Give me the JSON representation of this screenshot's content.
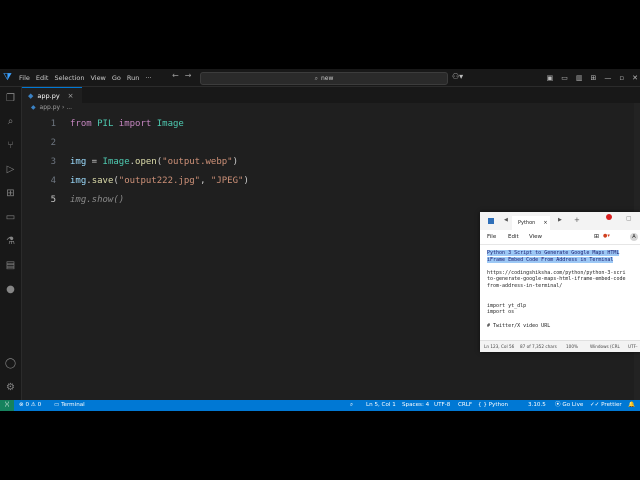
{
  "menu": [
    "File",
    "Edit",
    "Selection",
    "View",
    "Go",
    "Run"
  ],
  "search": {
    "label": "new"
  },
  "tab": {
    "name": "app.py",
    "close": "×"
  },
  "breadcrumb": {
    "file": "app.py",
    "rest": "..."
  },
  "code_lines": [
    {
      "n": "1"
    },
    {
      "n": "2"
    },
    {
      "n": "3"
    },
    {
      "n": "4"
    },
    {
      "n": "5"
    }
  ],
  "code": {
    "l1_from": "from",
    "l1_mod": "PIL",
    "l1_import": "import",
    "l1_cls": "Image",
    "l3_var": "img",
    "l3_eq": " = ",
    "l3_cls": "Image",
    "l3_dot": ".",
    "l3_fn": "open",
    "l3_p1": "(",
    "l3_str": "\"output.webp\"",
    "l3_p2": ")",
    "l4_var": "img",
    "l4_dot": ".",
    "l4_fn": "save",
    "l4_p1": "(",
    "l4_str1": "\"output222.jpg\"",
    "l4_comma": ", ",
    "l4_str2": "\"JPEG\"",
    "l4_p2": ")",
    "l5": "img.show()"
  },
  "status": {
    "errors": "0",
    "warnings": "0",
    "terminal": "Terminal",
    "position": "Ln 5, Col 1",
    "spaces": "Spaces: 4",
    "encoding": "UTF-8",
    "eol": "CRLF",
    "language": "Python",
    "version": "3.10.5",
    "golive": "Go Live",
    "prettier": "Prettier"
  },
  "notepad": {
    "tab": "Python",
    "menu": [
      "File",
      "Edit",
      "View"
    ],
    "hl1": "Python 3 Script to Generate Google Maps HTML",
    "hl2": "iFrame Embed Code From Address in Terminal",
    "url1": "https://codingshiksha.com/python/python-3-scri",
    "url2": "to-generate-google-maps-html-iframe-embed-code",
    "url3": "from-address-in-terminal/",
    "imp1": "import yt_dlp",
    "imp2": "import os",
    "cmt": "# Twitter/X video URL",
    "st_pos": "Ln 123, Col 56",
    "st_chars": "87 of 7,352 chars",
    "st_zoom": "100%",
    "st_eol": "Windows (CRL",
    "st_enc": "UTF-"
  },
  "colors": {
    "accent": "#0078d4",
    "editor_bg": "#1f1f1f",
    "keyword": "#c586c0",
    "string": "#ce9178"
  }
}
